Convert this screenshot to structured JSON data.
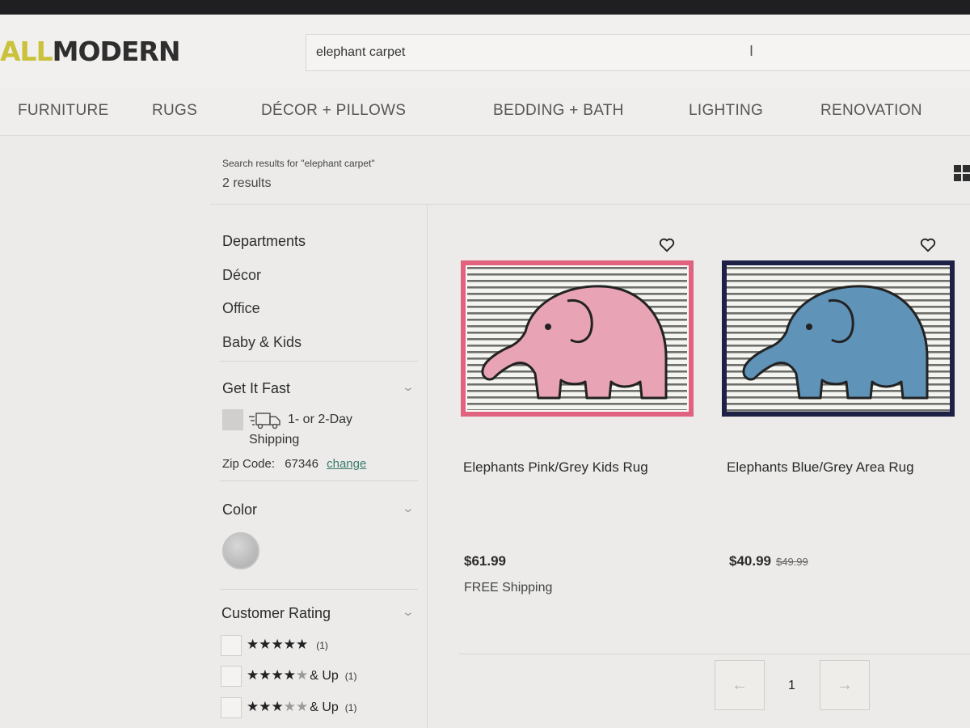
{
  "header": {
    "logo_accent": "ALL",
    "logo_main": "MODERN",
    "search_value": "elephant carpet"
  },
  "nav": [
    "FURNITURE",
    "RUGS",
    "DÉCOR + PILLOWS",
    "BEDDING + BATH",
    "LIGHTING",
    "RENOVATION"
  ],
  "results": {
    "heading": "Search results for \"elephant carpet\"",
    "count": "2 results"
  },
  "sidebar": {
    "departments_title": "Departments",
    "departments": [
      "Décor",
      "Office",
      "Baby & Kids"
    ],
    "get_it_fast": {
      "title": "Get It Fast",
      "option_line1": "1- or 2-Day",
      "option_line2": "Shipping",
      "zip_label": "Zip Code:",
      "zip_value": "67346",
      "zip_link": "change"
    },
    "color": {
      "title": "Color"
    },
    "rating": {
      "title": "Customer Rating",
      "rows": [
        {
          "stars": 5,
          "suffix": "",
          "count": "(1)"
        },
        {
          "stars": 4,
          "suffix": "& Up",
          "count": "(1)"
        },
        {
          "stars": 3,
          "suffix": "& Up",
          "count": "(1)"
        }
      ]
    }
  },
  "products": [
    {
      "name": "Elephants Pink/Grey Kids Rug",
      "price": "$61.99",
      "old_price": "",
      "shipping": "FREE Shipping",
      "border_color": "#e0627f",
      "elephant_color": "#e8a3b5"
    },
    {
      "name": "Elephants Blue/Grey Area Rug",
      "price": "$40.99",
      "old_price": "$49.99",
      "shipping": "",
      "border_color": "#1d2146",
      "elephant_color": "#5f93b8"
    }
  ],
  "pagination": {
    "current": "1"
  }
}
